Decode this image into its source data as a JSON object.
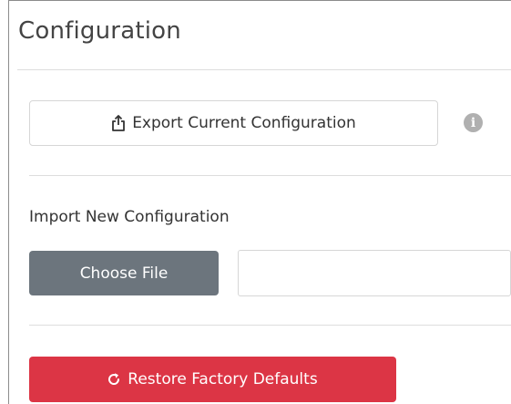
{
  "panel": {
    "title": "Configuration"
  },
  "export": {
    "label": "Export Current Configuration",
    "icon": "share-upload-icon",
    "info_icon": "info-icon"
  },
  "import": {
    "label": "Import New Configuration",
    "choose_button": "Choose File",
    "file_value": ""
  },
  "restore": {
    "label": "Restore Factory Defaults",
    "icon": "refresh-icon",
    "color": "#dc3545"
  },
  "colors": {
    "secondary_button": "#6c757d",
    "danger_button": "#dc3545",
    "info_icon": "#b0b0b0"
  }
}
